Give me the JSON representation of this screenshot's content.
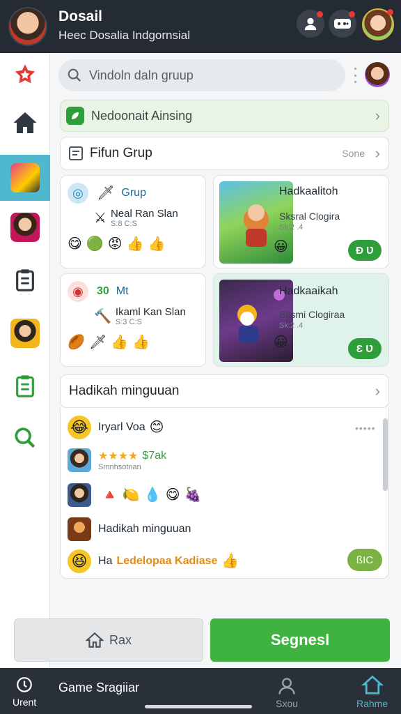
{
  "header": {
    "title": "Dosail",
    "subtitle": "Heec Dosalia Indgornsial"
  },
  "search": {
    "placeholder": "Vindoln daln gruup"
  },
  "banner": {
    "text": "Nedoonait Ainsing"
  },
  "group_section": {
    "title": "Fifun Grup",
    "count": "Sone"
  },
  "cards": [
    {
      "name": "Grup",
      "title": "Neal Ran Slan",
      "meta": "S:8 C:S",
      "emojis": [
        "😋",
        "🟢",
        "😡",
        "👍",
        "👍"
      ]
    },
    {
      "name": "Hadkaalitoh",
      "subtitle": "Sksral Clogira",
      "meta": "Sk:2 .4",
      "button": "Ð Ʋ"
    },
    {
      "name": "Mt",
      "badge": "30",
      "title": "Ikaml Kan Slan",
      "meta": "S:3 C:S",
      "emojis": [
        "👍",
        "👍"
      ]
    },
    {
      "name": "Hadkaaikah",
      "subtitle": "Sksmi Clogiraa",
      "meta": "Sk:2 .4",
      "button": "Ɛ Ʋ"
    }
  ],
  "weekly": {
    "title": "Hadikah minguuan",
    "items": [
      {
        "name": "Iryarl Voa",
        "emoji": "😊"
      },
      {
        "stars": "★★★★",
        "value": "$7ak",
        "meta": "Smnhsotnan"
      },
      {
        "emojis": [
          "🔺",
          "🍋",
          "💧",
          "😋",
          "🍇"
        ]
      },
      {
        "title": "Hadikah minguuan"
      },
      {
        "prefix": "Ha",
        "highlight": "Ledelopaa Kadiase",
        "emoji": "👍",
        "button": "ßIC"
      }
    ]
  },
  "actions": {
    "secondary": "Rax",
    "primary": "Segnesl"
  },
  "bottom_nav": {
    "left_label": "Urent",
    "middle_title": "Game Sragiiar",
    "right1_label": "Sxou",
    "right2_label": "Rahme"
  },
  "colors": {
    "header_bg": "#252b33",
    "accent_green": "#3fb33f",
    "active_tab": "#4fb8cf"
  }
}
